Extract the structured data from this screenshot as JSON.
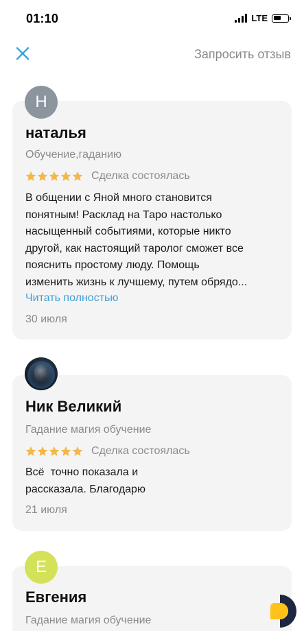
{
  "status": {
    "time": "01:10",
    "network": "LTE",
    "battery_level": 0.55
  },
  "nav": {
    "close_icon": "close-icon",
    "request_review": "Запросить отзыв"
  },
  "reviews": [
    {
      "initial": "Н",
      "avatar_color": "#8c949e",
      "name": "наталья",
      "category": "Обучение,гаданию",
      "rating": 5,
      "deal_status": "Сделка состоялась",
      "text_lines": [
        "В общении с Яной много становится",
        "понятным! Расклад на Таро настолько",
        "насыщенный событиями, которые никто",
        "другой, как настоящий таролог сможет все",
        "пояснить простому люду. Помощь",
        "изменить жизнь к лучшему, путем обрядо..."
      ],
      "read_more": "Читать полностью",
      "date": "30 июля"
    },
    {
      "initial": "",
      "avatar_color": "#1e2a38",
      "name": "Ник Великий",
      "category": "Гадание магия обучение",
      "rating": 5,
      "deal_status": "Сделка состоялась",
      "text_lines": [
        "Всё  точно показала и",
        "рассказала. Благодарю"
      ],
      "date": "21 июля"
    },
    {
      "initial": "Е",
      "avatar_color": "#d4e25a",
      "name": "Евгения",
      "category": "Гадание магия обучение"
    }
  ],
  "colors": {
    "accent_blue": "#3f9fd6",
    "star": "#f2b84b",
    "card_bg": "#f4f4f4",
    "muted_text": "#8a8a8a"
  },
  "fab": {
    "icon": "app-logo-icon"
  }
}
